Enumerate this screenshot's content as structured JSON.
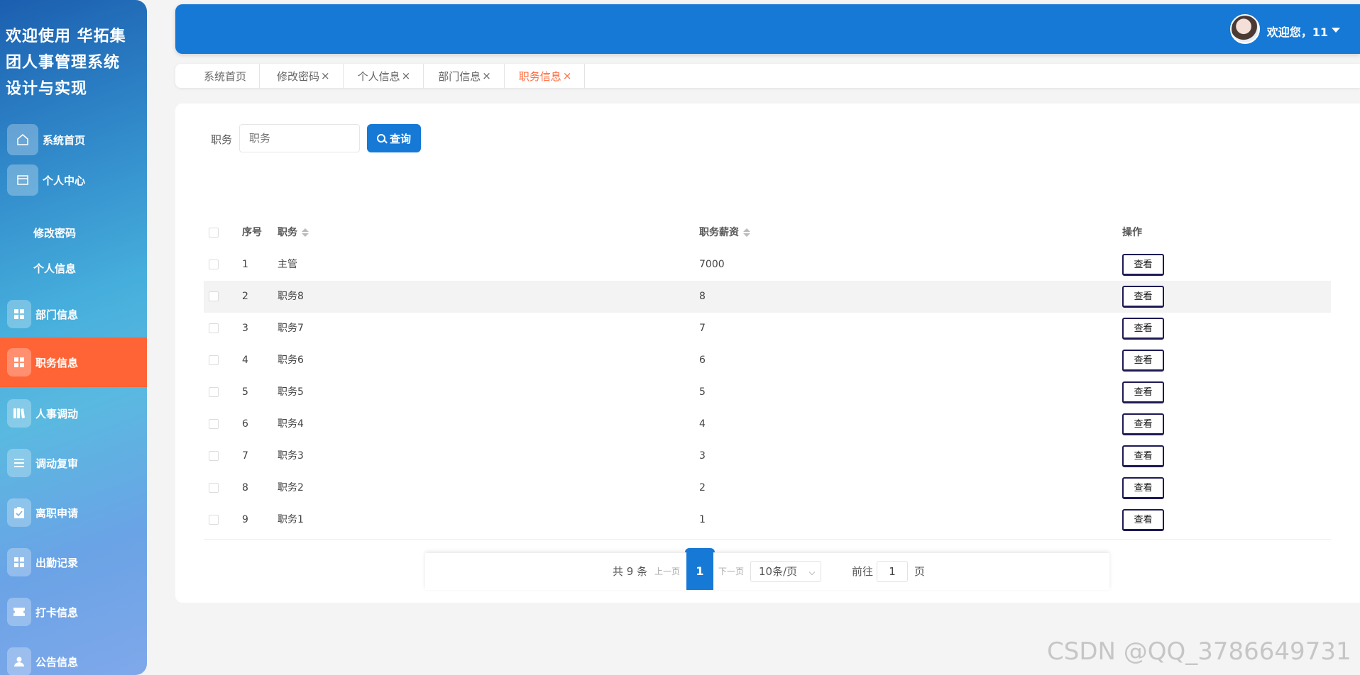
{
  "app": {
    "title": "欢迎使用 华拓集团人事管理系统设计与实现"
  },
  "sidebar": {
    "items": [
      {
        "label": "系统首页",
        "icon": "home-icon"
      },
      {
        "label": "个人中心",
        "icon": "window-icon"
      },
      {
        "label": "修改密码"
      },
      {
        "label": "个人信息"
      },
      {
        "label": "部门信息",
        "icon": "grid-icon"
      },
      {
        "label": "职务信息",
        "icon": "grid-icon",
        "active": true
      },
      {
        "label": "人事调动",
        "icon": "book-icon"
      },
      {
        "label": "调动复审",
        "icon": "list-icon"
      },
      {
        "label": "离职申请",
        "icon": "clipboard-icon"
      },
      {
        "label": "出勤记录",
        "icon": "grid-icon"
      },
      {
        "label": "打卡信息",
        "icon": "ticket-icon"
      },
      {
        "label": "公告信息",
        "icon": "user-icon"
      }
    ],
    "active_color": "#ff6436"
  },
  "header": {
    "welcome": "欢迎您，11",
    "bg_color": "#1679d6"
  },
  "tabs": [
    {
      "label": "系统首页",
      "close": ""
    },
    {
      "label": "修改密码",
      "close": "×"
    },
    {
      "label": "个人信息",
      "close": "×"
    },
    {
      "label": "部门信息",
      "close": "×"
    },
    {
      "label": "职务信息",
      "close": "×",
      "active": true
    }
  ],
  "search": {
    "label": "职务",
    "placeholder": "职务",
    "button": "查询"
  },
  "table": {
    "headers": {
      "index": "序号",
      "name": "职务",
      "salary": "职务薪资",
      "action": "操作"
    },
    "rows": [
      {
        "index": "1",
        "name": "主管",
        "salary": "7000",
        "action": "查看"
      },
      {
        "index": "2",
        "name": "职务8",
        "salary": "8",
        "action": "查看"
      },
      {
        "index": "3",
        "name": "职务7",
        "salary": "7",
        "action": "查看"
      },
      {
        "index": "4",
        "name": "职务6",
        "salary": "6",
        "action": "查看"
      },
      {
        "index": "5",
        "name": "职务5",
        "salary": "5",
        "action": "查看"
      },
      {
        "index": "6",
        "name": "职务4",
        "salary": "4",
        "action": "查看"
      },
      {
        "index": "7",
        "name": "职务3",
        "salary": "3",
        "action": "查看"
      },
      {
        "index": "8",
        "name": "职务2",
        "salary": "2",
        "action": "查看"
      },
      {
        "index": "9",
        "name": "职务1",
        "salary": "1",
        "action": "查看"
      }
    ]
  },
  "pagination": {
    "total": "共 9 条",
    "prev": "上一页",
    "current": "1",
    "next": "下一页",
    "page_size": "10条/页",
    "goto_label": "前往",
    "goto_value": "1",
    "page_suffix": "页"
  },
  "watermark": "CSDN @QQ_3786649731"
}
